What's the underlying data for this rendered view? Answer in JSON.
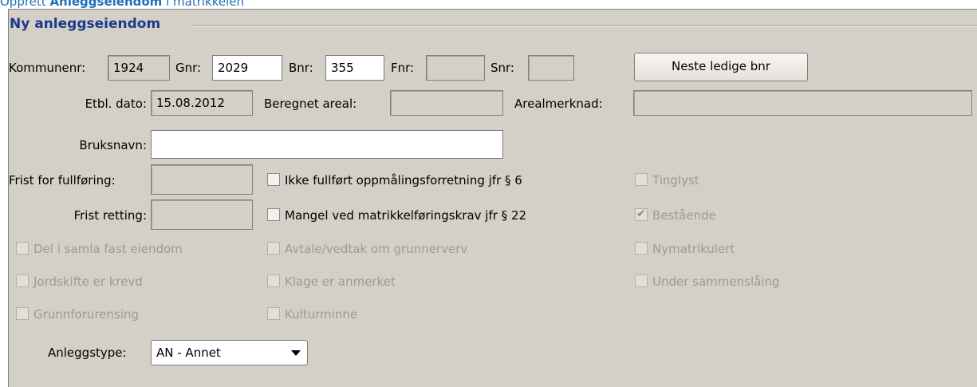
{
  "top_title": {
    "prefix": "Opprett ",
    "bold": "Anleggseiendom",
    "suffix": " i matrikkelen"
  },
  "group_title": "Ny anleggseiendom",
  "row1": {
    "kommunenr_label": "Kommunenr:",
    "kommunenr_value": "1924",
    "gnr_label": "Gnr:",
    "gnr_value": "2029",
    "bnr_label": "Bnr:",
    "bnr_value": "355",
    "fnr_label": "Fnr:",
    "fnr_value": "",
    "snr_label": "Snr:",
    "snr_value": "",
    "next_bnr_button": "Neste ledige bnr"
  },
  "row2": {
    "etbl_label": "Etbl. dato:",
    "etbl_value": "15.08.2012",
    "areal_label": "Beregnet areal:",
    "areal_value": "",
    "arealmerknad_label": "Arealmerknad:",
    "arealmerknad_value": ""
  },
  "row3": {
    "bruksnavn_label": "Bruksnavn:",
    "bruksnavn_value": ""
  },
  "row4": {
    "frist_fullforing_label": "Frist for fullføring:",
    "frist_fullforing_value": "",
    "ikke_fullfort": "Ikke fullført oppmålingsforretning jfr § 6",
    "tinglyst": "Tinglyst"
  },
  "row5": {
    "frist_retting_label": "Frist retting:",
    "frist_retting_value": "",
    "mangel": "Mangel ved matrikkelføringskrav jfr § 22",
    "bestaende": "Bestående"
  },
  "row6": {
    "del_i_samla": "Del i samla fast eiendom",
    "avtale": "Avtale/vedtak om grunnerverv",
    "nymatrikulert": "Nymatrikulert"
  },
  "row7": {
    "jordskifte": "Jordskifte er krevd",
    "klage": "Klage er anmerket",
    "sammenslaing": "Under sammenslåing"
  },
  "row8": {
    "grunnforurensing": "Grunnforurensing",
    "kulturminne": "Kulturminne"
  },
  "anleggstype": {
    "label": "Anleggstype:",
    "value": "AN - Annet"
  },
  "checkbox_state": {
    "bestaende_checked": true
  },
  "colors": {
    "title": "#1c3a8c",
    "panel": "#d4d0c8",
    "link": "#1f6fb8"
  }
}
